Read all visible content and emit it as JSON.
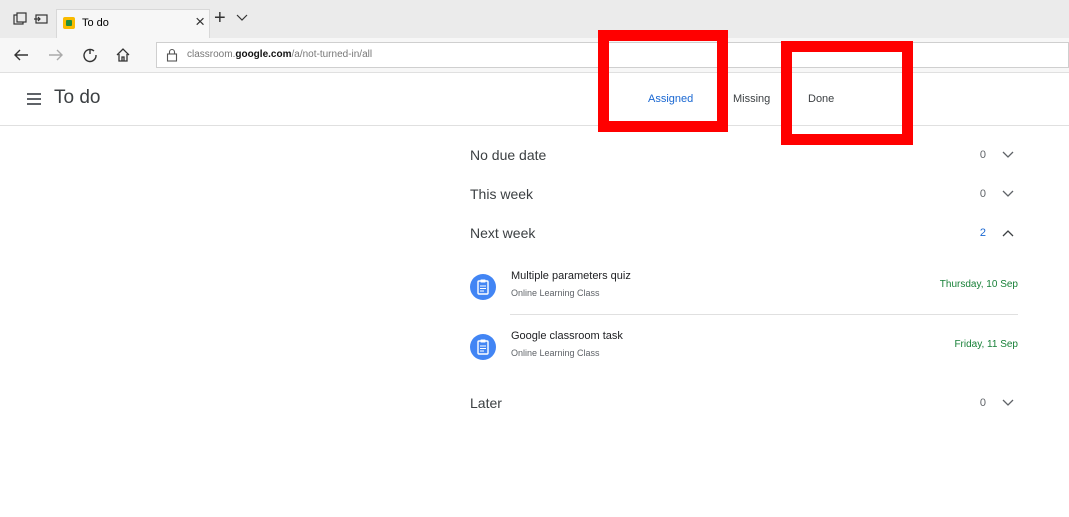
{
  "browser": {
    "tab_title": "To do",
    "url_host": "classroom.google.com",
    "url_path": "/a/not-turned-in/all",
    "url_prefix": "classroom."
  },
  "header": {
    "title": "To do",
    "tabs": [
      {
        "label": "Assigned",
        "active": true
      },
      {
        "label": "Missing",
        "active": false
      },
      {
        "label": "Done",
        "active": false
      }
    ]
  },
  "sections": [
    {
      "label": "No due date",
      "count": "0",
      "expanded": false
    },
    {
      "label": "This week",
      "count": "0",
      "expanded": false
    },
    {
      "label": "Next week",
      "count": "2",
      "expanded": true
    },
    {
      "label": "Later",
      "count": "0",
      "expanded": false
    }
  ],
  "tasks": [
    {
      "title": "Multiple parameters quiz",
      "class": "Online Learning Class",
      "due": "Thursday, 10 Sep",
      "icon": "assignment-icon"
    },
    {
      "title": "Google classroom task",
      "class": "Online Learning Class",
      "due": "Friday, 11 Sep",
      "icon": "assignment-icon"
    }
  ],
  "colors": {
    "accent": "#1967d2",
    "due": "#188038",
    "highlight": "#ff0000",
    "task_icon": "#4285f4"
  }
}
